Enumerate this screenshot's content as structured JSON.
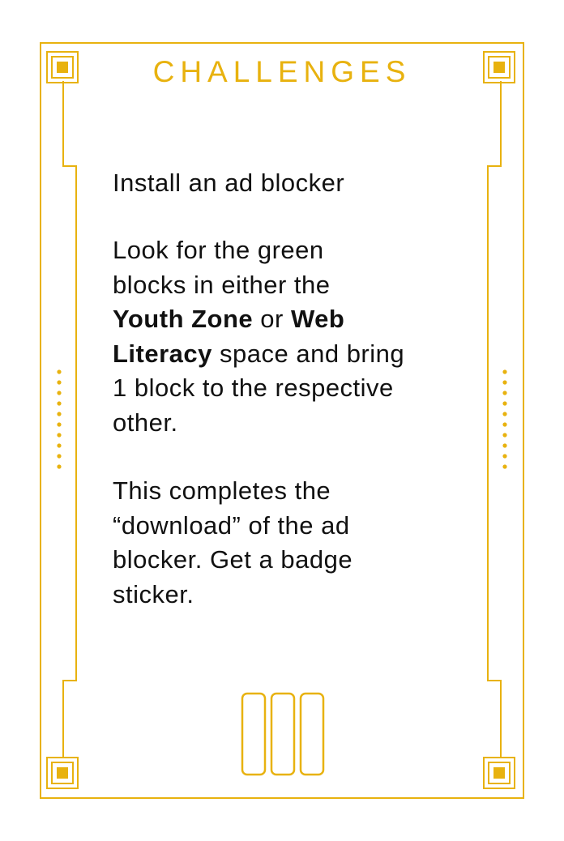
{
  "card": {
    "title": "CHALLENGES",
    "accent_color": "#e8b20f",
    "heading": "Install an ad blocker",
    "paragraph1": {
      "part1": "Look for the green blocks in either the ",
      "zone1": "Youth Zone",
      "part2": " or ",
      "zone2_a": "Web",
      "zone2_b": "Literacy",
      "part3": " space and bring 1 block to the respective other."
    },
    "paragraph2": "This completes the “download” of the ad blocker. Get a badge sticker."
  }
}
